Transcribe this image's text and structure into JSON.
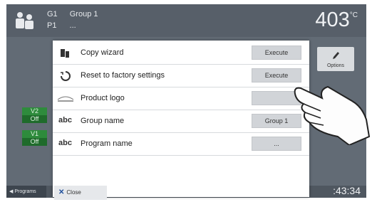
{
  "header": {
    "group_code": "G1",
    "group_name": "Group 1",
    "program_code": "P1",
    "program_name": "...",
    "temperature": "403",
    "temperature_unit": "°C"
  },
  "side_badges": [
    {
      "label": "V2",
      "state": "Off"
    },
    {
      "label": "V1",
      "state": "Off"
    }
  ],
  "options_button": {
    "label": "Options",
    "icon": "pencil-icon"
  },
  "bottom": {
    "programs_label": "Programs",
    "clock": ":43:34"
  },
  "dialog": {
    "rows": [
      {
        "icon": "copy-icon",
        "label": "Copy wizard",
        "button": "Execute"
      },
      {
        "icon": "reset-icon",
        "label": "Reset to factory settings",
        "button": "Execute"
      },
      {
        "icon": "logo-icon",
        "label": "Product logo",
        "button": ""
      },
      {
        "icon": "abc",
        "label": "Group name",
        "button": "Group 1"
      },
      {
        "icon": "abc",
        "label": "Program name",
        "button": "..."
      }
    ],
    "close_label": "Close"
  },
  "colors": {
    "header_bg": "#575f69",
    "badge_green": "#2e8b3c",
    "button_bg": "#d1d4d8"
  }
}
